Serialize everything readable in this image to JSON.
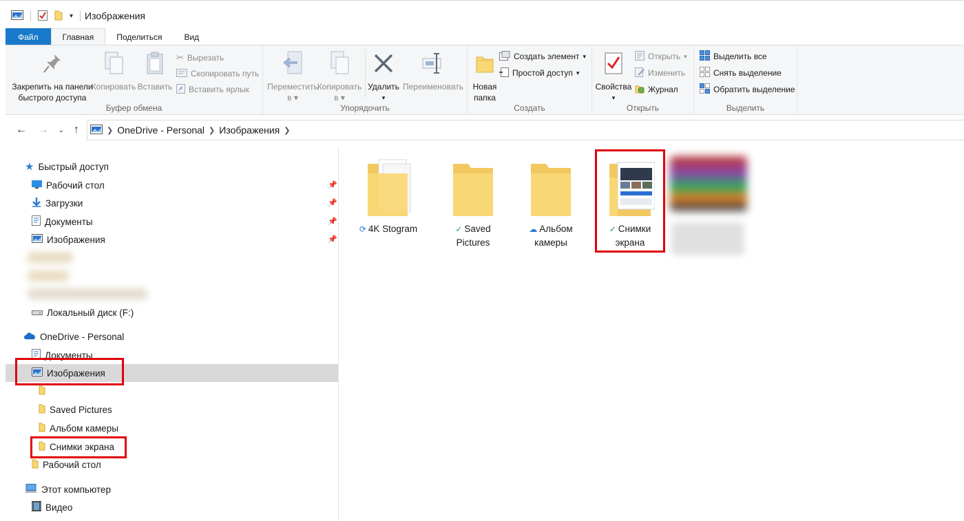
{
  "window": {
    "title": "Изображения"
  },
  "ribbon": {
    "tabs": [
      "Файл",
      "Главная",
      "Поделиться",
      "Вид"
    ],
    "clipboard": {
      "pin_label_1": "Закрепить на панели",
      "pin_label_2": "быстрого доступа",
      "copy": "Копировать",
      "paste": "Вставить",
      "cut": "Вырезать",
      "copy_path": "Скопировать путь",
      "paste_shortcut": "Вставить ярлык",
      "label": "Буфер обмена"
    },
    "organize": {
      "move_1": "Переместить",
      "move_2": "в",
      "copyto_1": "Копировать",
      "copyto_2": "в",
      "delete": "Удалить",
      "rename": "Переименовать",
      "label": "Упорядочить"
    },
    "create": {
      "new_folder_1": "Новая",
      "new_folder_2": "папка",
      "new_item": "Создать элемент",
      "easy_access": "Простой доступ",
      "label": "Создать"
    },
    "open": {
      "properties": "Свойства",
      "open": "Открыть",
      "edit": "Изменить",
      "history": "Журнал",
      "label": "Открыть"
    },
    "select": {
      "select_all": "Выделить все",
      "select_none": "Снять выделение",
      "invert": "Обратить выделение",
      "label": "Выделить"
    }
  },
  "address": {
    "crumbs": [
      "OneDrive - Personal",
      "Изображения"
    ]
  },
  "nav": {
    "quick_access": "Быстрый доступ",
    "qa_items": [
      "Рабочий стол",
      "Загрузки",
      "Документы",
      "Изображения"
    ],
    "local_disk": "Локальный диск (F:)",
    "onedrive": "OneDrive - Personal",
    "od_documents": "Документы",
    "od_pictures": "Изображения",
    "od_sub": [
      "Saved Pictures",
      "Альбом камеры",
      "Снимки экрана"
    ],
    "od_desktop": "Рабочий стол",
    "this_pc": "Этот компьютер",
    "video": "Видео"
  },
  "files": [
    {
      "line1": "4K Stogram",
      "line2": "",
      "status": "sync"
    },
    {
      "line1": "Saved",
      "line2": "Pictures",
      "status": "ok"
    },
    {
      "line1": "Альбом",
      "line2": "камеры",
      "status": "cloud"
    },
    {
      "line1": "Снимки",
      "line2": "экрана",
      "status": "ok"
    }
  ],
  "colors": {
    "accent": "#1979ca",
    "highlight": "#e0000b",
    "folder": "#f8d775"
  }
}
